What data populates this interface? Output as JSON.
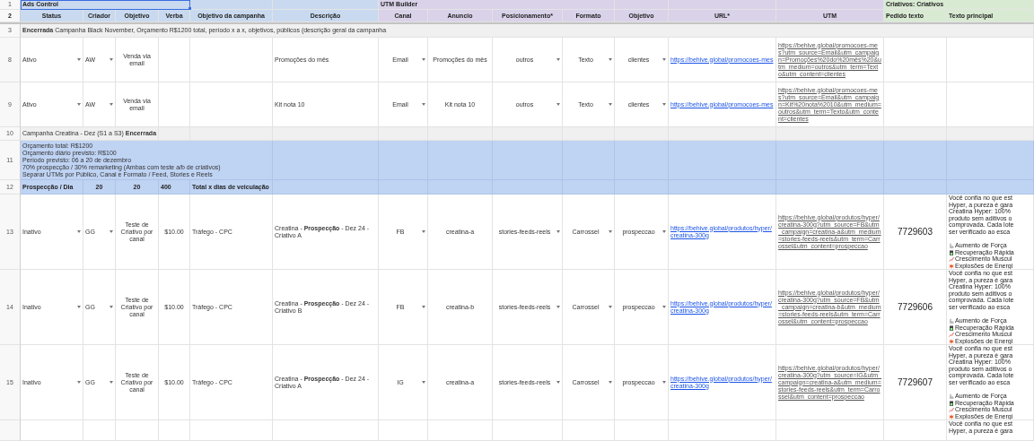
{
  "column_groups": [
    {
      "title": "Ads Control",
      "selected": true,
      "columns": [
        "Status",
        "Criador",
        "Objetivo",
        "Verba",
        "Objetivo da campanha",
        "Descrição"
      ]
    },
    {
      "title": "UTM Builder",
      "selected": false,
      "columns": [
        "Canal",
        "Anuncio",
        "Posicionamento*",
        "Formato",
        "Objetivo",
        "URL*",
        "UTM"
      ]
    },
    {
      "title": "Criativos: Criativos",
      "selected": false,
      "columns": [
        "Pedido texto",
        "Texto principal"
      ]
    }
  ],
  "header_numbers": [
    "1",
    "2"
  ],
  "rows": [
    {
      "number": "3",
      "kind": "section",
      "text": "**Encerrada** Campanha Black November, Orçamento R$1200 total, período x a x, objetivos, públicos (descrição geral da campanha"
    },
    {
      "number": "8",
      "kind": "ad",
      "status": "Ativo",
      "criador": "AW",
      "objetivo": "Venda via email",
      "descricao": "Promoções do mês",
      "canal": "Email",
      "anuncio": "Promoções do mês",
      "posicionamento": "outros",
      "formato": "Texto",
      "objetivo_anuncio": "clientes",
      "url": "https://behive.global/promocoes-mes",
      "utm": "https://behive.global/promocoes-mes?utm_source=Email&utm_campaign=Promoções%20do%20mês%20&utm_medium=outros&utm_term=Texto&utm_content=clientes"
    },
    {
      "number": "9",
      "kind": "ad",
      "status": "Ativo",
      "criador": "AW",
      "objetivo": "Venda via email",
      "descricao": "Kit nota 10",
      "canal": "Email",
      "anuncio": "Kit nota 10",
      "posicionamento": "outros",
      "formato": "Texto",
      "objetivo_anuncio": "clientes",
      "url": "https://behive.global/promocoes-mes",
      "utm": "https://behive.global/promocoes-mes?utm_source=Email&utm_campaign=Kit%20nota%2010&utm_medium=outros&utm_term=Texto&utm_content=clientes"
    },
    {
      "number": "10",
      "kind": "section",
      "text": "Campanha Creatina - Dez (S1 a S3) **Encerrada**"
    },
    {
      "number": "11",
      "kind": "note",
      "lines": [
        "Orçamento total: R$1200",
        "Orçamento diário previsto: R$100",
        "Período previsto: 06 a 20 de dezembro",
        "70% prospecção / 30% remarketing (Ambas com teste a/b de criativos)",
        "Separar UTMs por Público, Canal e Formato / Feed, Stories e Reels"
      ]
    },
    {
      "number": "12",
      "kind": "summary",
      "label": "Prospecção / Dia",
      "criador": "20",
      "objetivo": "20",
      "verba": "400",
      "objetivo_campanha": "Total x dias de veiculação"
    },
    {
      "number": "13",
      "kind": "ad",
      "status": "Inativo",
      "criador": "GG",
      "objetivo": "Teste de Criativo por canal",
      "verba": "$10.00",
      "objetivo_campanha": "Tráfego - CPC",
      "descricao": "Creatina - **Prospecção** - Dez 24 - Criativo A",
      "canal": "FB",
      "anuncio": "creatina-a",
      "posicionamento": "stories-feeds-reels",
      "formato": "Carrossel",
      "objetivo_anuncio": "prospeccao",
      "url": "https://behive.global/produtos/hyper/creatina-300g",
      "utm": "https://behive.global/produtos/hyper/creatina-300g?utm_source=FB&utm_campaign=creatina-a&utm_medium=stories-feeds-reels&utm_term=Carrossel&utm_content=prospeccao",
      "pedido_texto": "7729603",
      "texto_principal": {
        "lines": [
          "Você confia no que est",
          "Hyper, a pureza é gara",
          "Creatina Hyper: 100%",
          "produto sem aditivos o",
          "comprovada. Cada lote",
          "ser verificado ao esca"
        ],
        "bullets": [
          "Aumento de Força",
          "Recuperação Rápida",
          "Crescimento Muscul",
          "Explosões de Energi"
        ]
      }
    },
    {
      "number": "14",
      "kind": "ad",
      "status": "Inativo",
      "criador": "GG",
      "objetivo": "Teste de Criativo por canal",
      "verba": "$10.00",
      "objetivo_campanha": "Tráfego - CPC",
      "descricao": "Creatina - **Prospecção** - Dez 24 - Criativo B",
      "canal": "FB",
      "anuncio": "creatina-b",
      "posicionamento": "stories-feeds-reels",
      "formato": "Carrossel",
      "objetivo_anuncio": "prospeccao",
      "url": "https://behive.global/produtos/hyper/creatina-300g",
      "utm": "https://behive.global/produtos/hyper/creatina-300g?utm_source=FB&utm_campaign=creatina-b&utm_medium=stories-feeds-reels&utm_term=Carrossel&utm_content=prospeccao",
      "pedido_texto": "7729606",
      "texto_principal": {
        "lines": [
          "Você confia no que est",
          "Hyper, a pureza é gara",
          "Creatina Hyper: 100%",
          "produto sem aditivos o",
          "comprovada. Cada lote",
          "ser verificado ao esca"
        ],
        "bullets": [
          "Aumento de Força",
          "Recuperação Rápida",
          "Crescimento Muscul",
          "Explosões de Energi"
        ]
      }
    },
    {
      "number": "15",
      "kind": "ad",
      "status": "Inativo",
      "criador": "GG",
      "objetivo": "Teste de Criativo por canal",
      "verba": "$10.00",
      "objetivo_campanha": "Tráfego - CPC",
      "descricao": "Creatina - **Prospecção** - Dez 24 - Criativo A",
      "canal": "IG",
      "anuncio": "creatina-a",
      "posicionamento": "stories-feeds-reels",
      "formato": "Carrossel",
      "objetivo_anuncio": "prospeccao",
      "url": "https://behive.global/produtos/hyper/creatina-300g",
      "utm": "https://behive.global/produtos/hyper/creatina-300g?utm_source=IG&utm_campaign=creatina-a&utm_medium=stories-feeds-reels&utm_term=Carrossel&utm_content=prospeccao",
      "pedido_texto": "7729607",
      "texto_principal": {
        "lines": [
          "Você confia no que est",
          "Hyper, a pureza é gara",
          "Creatina Hyper: 100%",
          "produto sem aditivos o",
          "comprovada. Cada lote",
          "ser verificado ao esca"
        ],
        "bullets": [
          "Aumento de Força",
          "Recuperação Rápida",
          "Crescimento Muscul",
          "Explosões de Energi"
        ]
      }
    },
    {
      "kind": "ad",
      "texto_principal": {
        "lines": [
          "Você confia no que est",
          "Hyper, a pureza é gara"
        ]
      }
    }
  ]
}
